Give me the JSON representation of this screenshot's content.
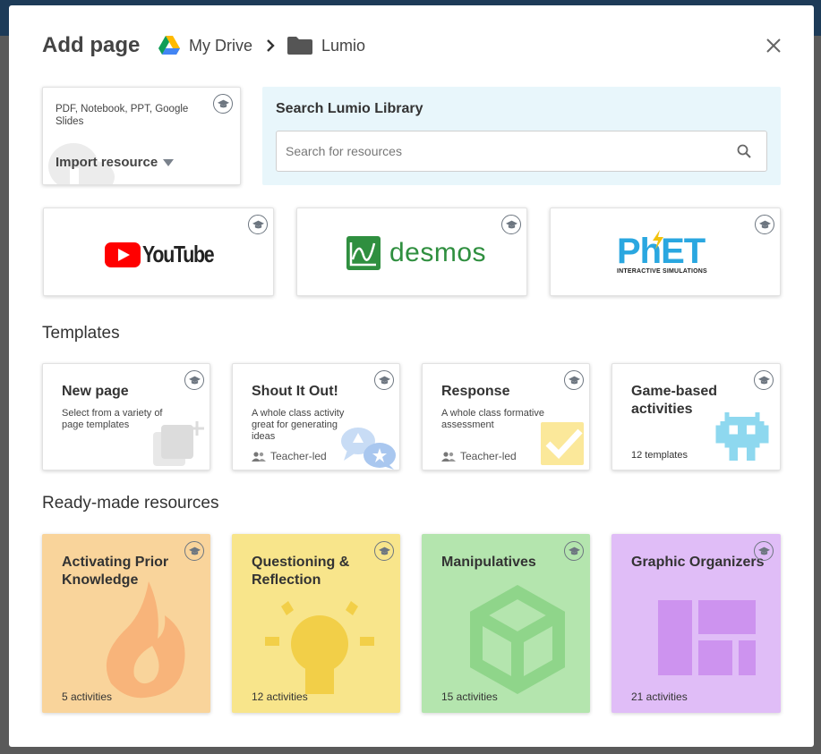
{
  "dialog": {
    "title": "Add page",
    "breadcrumb": {
      "drive": "My Drive",
      "folder": "Lumio"
    }
  },
  "import": {
    "subtitle": "PDF, Notebook, PPT, Google Slides",
    "button_label": "Import resource"
  },
  "search": {
    "title": "Search Lumio Library",
    "placeholder": "Search for resources"
  },
  "integrations": [
    {
      "name": "YouTube",
      "logo": "youtube-logo"
    },
    {
      "name": "desmos",
      "logo": "desmos-logo"
    },
    {
      "name": "PhET",
      "tagline": "INTERACTIVE SIMULATIONS",
      "logo": "phet-logo"
    }
  ],
  "templates": {
    "heading": "Templates",
    "items": [
      {
        "title": "New page",
        "description": "Select from a variety of page templates",
        "footer": ""
      },
      {
        "title": "Shout It Out!",
        "description": "A whole class activity great for generating ideas",
        "footer": "Teacher-led"
      },
      {
        "title": "Response",
        "description": "A whole class formative assessment",
        "footer": "Teacher-led"
      },
      {
        "title": "Game-based activities",
        "description": "",
        "footer": "12 templates"
      }
    ]
  },
  "ready_made": {
    "heading": "Ready-made resources",
    "items": [
      {
        "title": "Activating Prior Knowledge",
        "count": "5 activities",
        "color": "#f9d49b"
      },
      {
        "title": "Questioning & Reflection",
        "count": "12 activities",
        "color": "#f8e58b"
      },
      {
        "title": "Manipulatives",
        "count": "15 activities",
        "color": "#b4e5ae"
      },
      {
        "title": "Graphic Organizers",
        "count": "21 activities",
        "color": "#e0bdf7"
      }
    ]
  },
  "colors": {
    "header_strip": "#1d3b58",
    "search_panel": "#e8f6fb",
    "youtube_red": "#ff0000",
    "desmos_green": "#2f8f3f",
    "phet_blue": "#2aa7e0",
    "phet_yellow": "#f2c20c"
  }
}
